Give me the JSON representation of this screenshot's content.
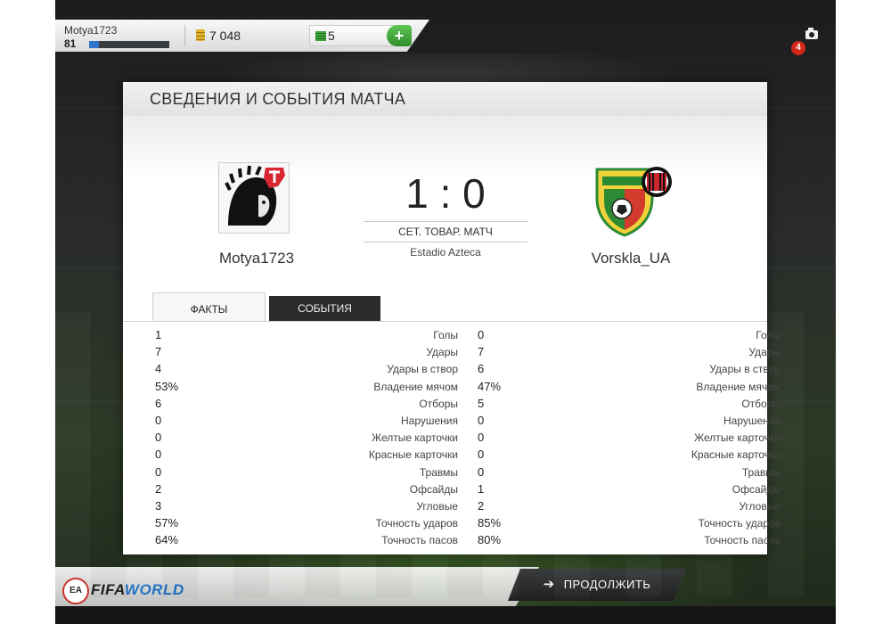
{
  "topbar": {
    "username": "Motya1723",
    "level": "81",
    "xp_progress_fraction": 0.12,
    "coins": "7 048",
    "tokens": "5",
    "add_label": "+",
    "notifications": "4"
  },
  "panel": {
    "title": "СВЕДЕНИЯ И СОБЫТИЯ МАТЧА",
    "home": {
      "name": "Motya1723"
    },
    "away": {
      "name": "Vorskla_UA"
    },
    "score": "1 : 0",
    "match_type": "СЕТ. ТОВАР. МАТЧ",
    "stadium": "Estadio Azteca",
    "tabs": [
      "ФАКТЫ",
      "СОБЫТИЯ"
    ],
    "stats": [
      {
        "label": "Голы",
        "home": "1",
        "away": "0"
      },
      {
        "label": "Удары",
        "home": "7",
        "away": "7"
      },
      {
        "label": "Удары в створ",
        "home": "4",
        "away": "6"
      },
      {
        "label": "Владение мячом",
        "home": "53%",
        "away": "47%"
      },
      {
        "label": "Отборы",
        "home": "6",
        "away": "5"
      },
      {
        "label": "Нарушения",
        "home": "0",
        "away": "0"
      },
      {
        "label": "Желтые карточки",
        "home": "0",
        "away": "0"
      },
      {
        "label": "Красные карточки",
        "home": "0",
        "away": "0"
      },
      {
        "label": "Травмы",
        "home": "0",
        "away": "0"
      },
      {
        "label": "Офсайды",
        "home": "2",
        "away": "1"
      },
      {
        "label": "Угловые",
        "home": "3",
        "away": "2"
      },
      {
        "label": "Точность ударов",
        "home": "57%",
        "away": "85%"
      },
      {
        "label": "Точность пасов",
        "home": "64%",
        "away": "80%"
      }
    ]
  },
  "footer": {
    "ea_label": "EA",
    "fifa_label": "FIFA",
    "world_label": "WORLD",
    "continue_label": "ПРОДОЛЖИТЬ"
  },
  "colors": {
    "accent_blue": "#2f74c8",
    "token_green": "#41a83c",
    "badge_red": "#d4271c",
    "button_dark": "#2a2b2c"
  }
}
